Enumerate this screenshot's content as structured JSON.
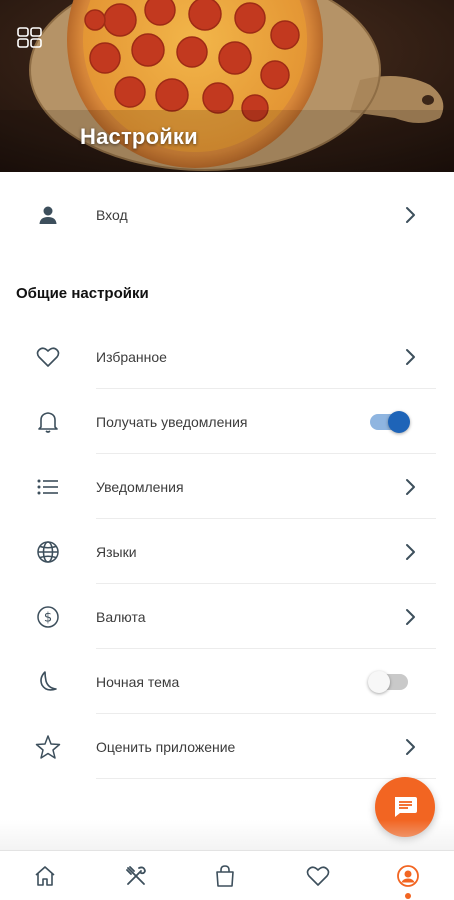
{
  "header": {
    "title": "Настройки",
    "menu_icon": "grid-icon"
  },
  "login_row": {
    "label": "Вход",
    "icon": "person-icon"
  },
  "section": {
    "title": "Общие настройки"
  },
  "settings": [
    {
      "label": "Избранное",
      "icon": "heart-icon",
      "control": "chevron"
    },
    {
      "label": "Получать уведомления",
      "icon": "bell-icon",
      "control": "toggle",
      "enabled": true
    },
    {
      "label": "Уведомления",
      "icon": "list-icon",
      "control": "chevron"
    },
    {
      "label": "Языки",
      "icon": "globe-icon",
      "control": "chevron"
    },
    {
      "label": "Валюта",
      "icon": "dollar-coin-icon",
      "control": "chevron"
    },
    {
      "label": "Ночная тема",
      "icon": "moon-icon",
      "control": "toggle",
      "enabled": false
    },
    {
      "label": "Оценить приложение",
      "icon": "star-icon",
      "control": "chevron"
    }
  ],
  "fab": {
    "icon": "chat-icon"
  },
  "tabbar": {
    "tabs": [
      "home-icon",
      "cutlery-icon",
      "shopping-bag-icon",
      "heart-icon",
      "profile-icon"
    ],
    "active_tab": "profile-icon"
  },
  "colors": {
    "accent": "#f26522",
    "toggle_on": "#1e64b8",
    "icon": "#3d4f5c"
  }
}
